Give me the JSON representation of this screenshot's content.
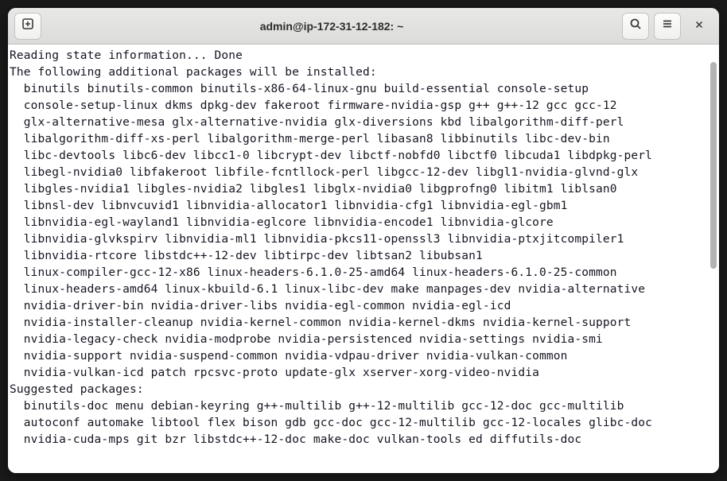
{
  "title": "admin@ip-172-31-12-182: ~",
  "terminal": {
    "lines": [
      "Reading state information... Done",
      "The following additional packages will be installed:",
      "  binutils binutils-common binutils-x86-64-linux-gnu build-essential console-setup",
      "  console-setup-linux dkms dpkg-dev fakeroot firmware-nvidia-gsp g++ g++-12 gcc gcc-12",
      "  glx-alternative-mesa glx-alternative-nvidia glx-diversions kbd libalgorithm-diff-perl",
      "  libalgorithm-diff-xs-perl libalgorithm-merge-perl libasan8 libbinutils libc-dev-bin",
      "  libc-devtools libc6-dev libcc1-0 libcrypt-dev libctf-nobfd0 libctf0 libcuda1 libdpkg-perl",
      "  libegl-nvidia0 libfakeroot libfile-fcntllock-perl libgcc-12-dev libgl1-nvidia-glvnd-glx",
      "  libgles-nvidia1 libgles-nvidia2 libgles1 libglx-nvidia0 libgprofng0 libitm1 liblsan0",
      "  libnsl-dev libnvcuvid1 libnvidia-allocator1 libnvidia-cfg1 libnvidia-egl-gbm1",
      "  libnvidia-egl-wayland1 libnvidia-eglcore libnvidia-encode1 libnvidia-glcore",
      "  libnvidia-glvkspirv libnvidia-ml1 libnvidia-pkcs11-openssl3 libnvidia-ptxjitcompiler1",
      "  libnvidia-rtcore libstdc++-12-dev libtirpc-dev libtsan2 libubsan1",
      "  linux-compiler-gcc-12-x86 linux-headers-6.1.0-25-amd64 linux-headers-6.1.0-25-common",
      "  linux-headers-amd64 linux-kbuild-6.1 linux-libc-dev make manpages-dev nvidia-alternative",
      "  nvidia-driver-bin nvidia-driver-libs nvidia-egl-common nvidia-egl-icd",
      "  nvidia-installer-cleanup nvidia-kernel-common nvidia-kernel-dkms nvidia-kernel-support",
      "  nvidia-legacy-check nvidia-modprobe nvidia-persistenced nvidia-settings nvidia-smi",
      "  nvidia-support nvidia-suspend-common nvidia-vdpau-driver nvidia-vulkan-common",
      "  nvidia-vulkan-icd patch rpcsvc-proto update-glx xserver-xorg-video-nvidia",
      "Suggested packages:",
      "  binutils-doc menu debian-keyring g++-multilib g++-12-multilib gcc-12-doc gcc-multilib",
      "  autoconf automake libtool flex bison gdb gcc-doc gcc-12-multilib gcc-12-locales glibc-doc",
      "  nvidia-cuda-mps git bzr libstdc++-12-doc make-doc vulkan-tools ed diffutils-doc"
    ]
  }
}
